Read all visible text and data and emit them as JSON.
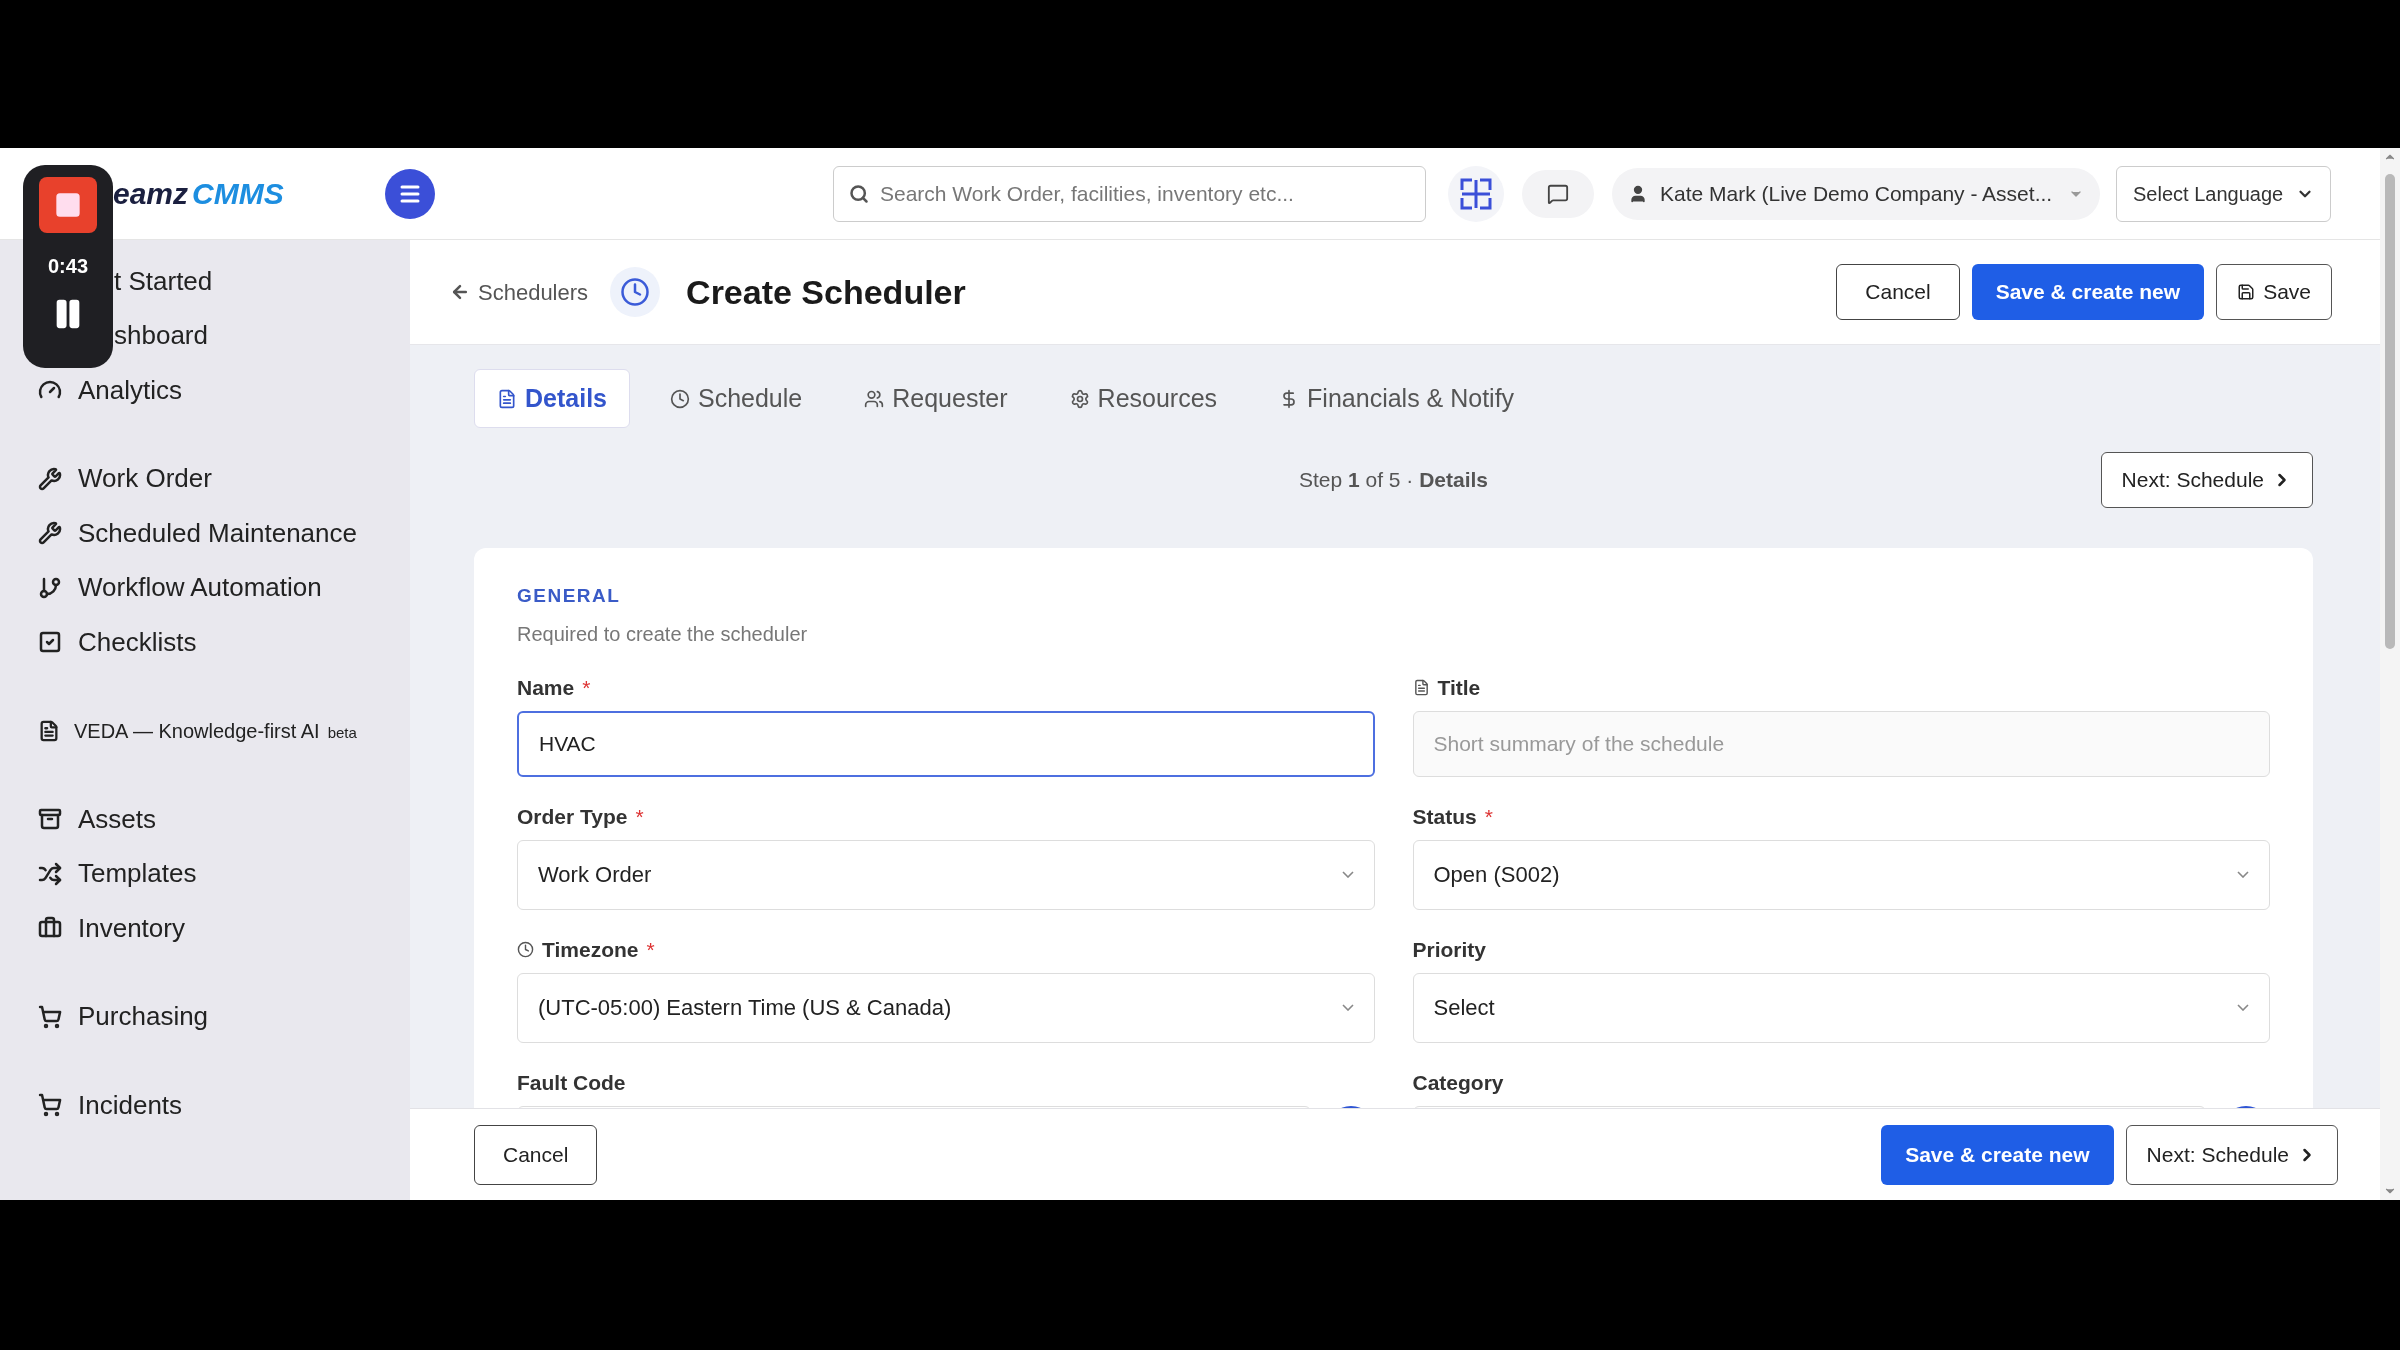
{
  "recorder": {
    "time": "0:43"
  },
  "logo": {
    "text": "eamz",
    "accent": "CMMS"
  },
  "search": {
    "placeholder": "Search Work Order, facilities, inventory etc..."
  },
  "user_menu": {
    "label": "Kate Mark (Live Demo Company - Asset..."
  },
  "language_select": {
    "value": "Select Language"
  },
  "sidebar": {
    "groups": [
      {
        "items": [
          {
            "label": "t Started",
            "kind": "covered"
          },
          {
            "label": "shboard",
            "kind": "covered"
          },
          {
            "label": "Analytics",
            "kind": "link"
          }
        ]
      },
      {
        "items": [
          {
            "label": "Work Order",
            "kind": "link"
          },
          {
            "label": "Scheduled Maintenance",
            "kind": "link"
          },
          {
            "label": "Workflow Automation",
            "kind": "link"
          },
          {
            "label": "Checklists",
            "kind": "link"
          }
        ]
      },
      {
        "items": [
          {
            "label": "VEDA — Knowledge-first AI",
            "badge": "beta",
            "kind": "small"
          }
        ]
      },
      {
        "items": [
          {
            "label": "Assets",
            "kind": "link"
          },
          {
            "label": "Templates",
            "kind": "link"
          },
          {
            "label": "Inventory",
            "kind": "link"
          }
        ]
      },
      {
        "items": [
          {
            "label": "Purchasing",
            "kind": "link"
          }
        ]
      },
      {
        "items": [
          {
            "label": "Incidents",
            "kind": "link"
          }
        ]
      }
    ]
  },
  "page": {
    "back_link": "Schedulers",
    "title": "Create Scheduler",
    "buttons": [
      {
        "label": "Cancel",
        "kind": "secondary"
      },
      {
        "label": "Save & create new",
        "kind": "primary"
      },
      {
        "label": "Save",
        "kind": "save"
      }
    ]
  },
  "tabs": [
    {
      "label": "Details",
      "selected": true
    },
    {
      "label": "Schedule",
      "selected": false
    },
    {
      "label": "Requester",
      "selected": false
    },
    {
      "label": "Resources",
      "selected": false
    },
    {
      "label": "Financials & Notify",
      "selected": false
    }
  ],
  "step": {
    "text": "Step **1** of 5 · **Details**",
    "button": {
      "label": "Next: Schedule",
      "kind": "next"
    }
  },
  "form": {
    "heading": "GENERAL",
    "subtitle": "Required to create the scheduler",
    "fields": [
      {
        "label": "Name",
        "required_mark": "*",
        "kind": "input",
        "value": "HVAC",
        "focused": true
      },
      {
        "label": "Title",
        "kind": "input",
        "placeholder": "Short summary of the schedule",
        "focused": false
      },
      {
        "label": "Order Type",
        "required_mark": "*",
        "kind": "select",
        "value": "Work Order"
      },
      {
        "label": "Status",
        "required_mark": "*",
        "kind": "select",
        "value": "Open (S002)"
      },
      {
        "label": "Timezone",
        "required_mark": "*",
        "kind": "select",
        "value": "(UTC-05:00) Eastern Time (US & Canada)"
      },
      {
        "label": "Priority",
        "kind": "select",
        "value": "Select"
      },
      {
        "label": "Fault Code",
        "kind": "lookup"
      },
      {
        "label": "Category",
        "kind": "lookup"
      }
    ]
  },
  "footer": {
    "buttons": [
      {
        "label": "Cancel",
        "kind": "secondary"
      },
      {
        "label": "Save & create new",
        "kind": "primary"
      },
      {
        "label": "Next: Schedule",
        "kind": "next"
      }
    ]
  }
}
